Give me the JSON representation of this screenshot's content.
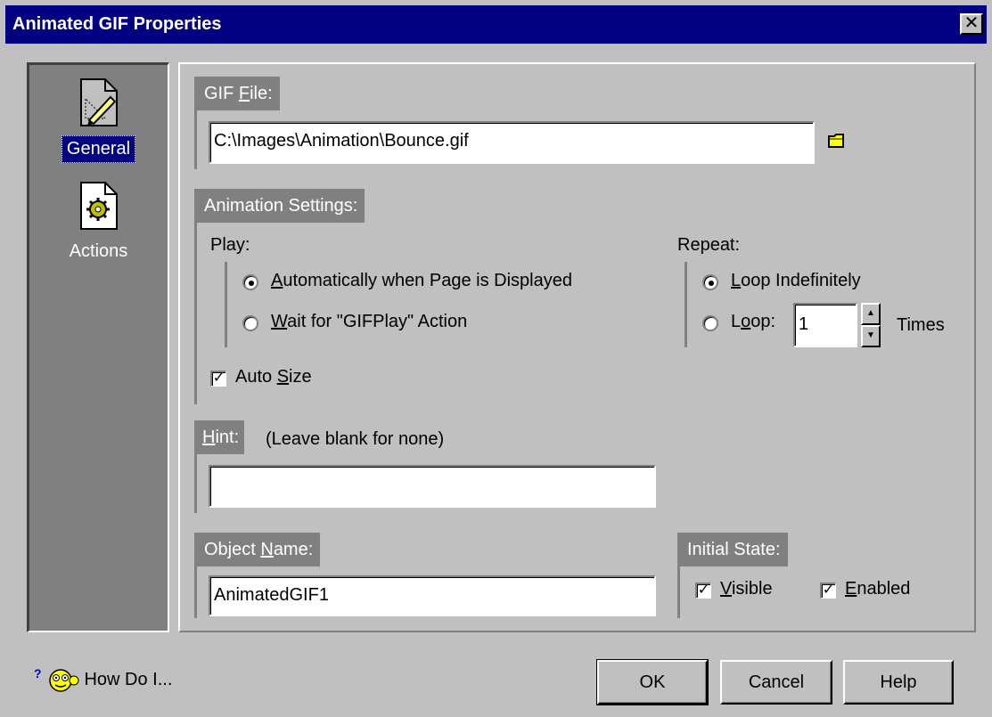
{
  "title": "Animated GIF Properties",
  "close_glyph": "✕",
  "sidebar": {
    "items": [
      {
        "label": "General",
        "icon": "pencil-document-icon"
      },
      {
        "label": "Actions",
        "icon": "gear-document-icon"
      }
    ]
  },
  "gif_file": {
    "label_pre": "GIF ",
    "label_mnemonic": "F",
    "label_post": "ile:",
    "value": "C:\\Images\\Animation\\Bounce.gif",
    "browse_icon": "folder-icon"
  },
  "animation": {
    "label": "Animation Settings:",
    "play_label": "Play:",
    "play_auto_mnemonic": "A",
    "play_auto_rest": "utomatically when Page is Displayed",
    "play_wait_mnemonic": "W",
    "play_wait_rest": "ait for \"GIFPlay\" Action",
    "repeat_label": "Repeat:",
    "loop_indef_mnemonic": "L",
    "loop_indef_rest": "oop Indefinitely",
    "loop_pre": "L",
    "loop_mnemonic": "o",
    "loop_post": "op:",
    "loop_value": "1",
    "times_label": "Times",
    "autosize_pre": "Auto ",
    "autosize_mnemonic": "S",
    "autosize_post": "ize",
    "check_glyph": "✓"
  },
  "hint": {
    "label_mnemonic": "H",
    "label_post": "int:",
    "note": "(Leave blank for none)",
    "value": ""
  },
  "object_name": {
    "label_pre": "Object ",
    "label_mnemonic": "N",
    "label_post": "ame:",
    "value": "AnimatedGIF1"
  },
  "initial_state": {
    "label": "Initial State:",
    "visible_mnemonic": "V",
    "visible_rest": "isible",
    "enabled_mnemonic": "E",
    "enabled_rest": "nabled"
  },
  "footer": {
    "how_do_i": "How Do I...",
    "ok": "OK",
    "cancel": "Cancel",
    "help": "Help"
  }
}
